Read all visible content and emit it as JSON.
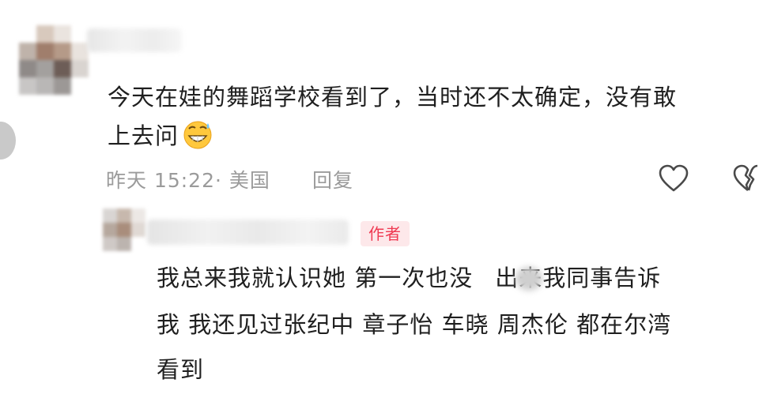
{
  "comment": {
    "text_line1": "今天在娃的舞蹈学校看到了，当时还不太确定，没有敢",
    "text_line2": "上去问",
    "emoji": "grinning-face-with-sweat-icon",
    "time_location": "昨天 15:22· 美国",
    "reply_label": "回复"
  },
  "reply": {
    "author_badge": "作者",
    "line1": "我总来我就认识她 第一次也没",
    "line1_b": "出来我同事告诉",
    "line2": "我 我还见过张纪中 章子怡 车晓 周杰伦 都在尔湾",
    "line3": "看到"
  },
  "colors": {
    "badge_bg": "#fde8ea",
    "badge_text": "#ef3a52",
    "meta_text": "#9b9b9b"
  }
}
